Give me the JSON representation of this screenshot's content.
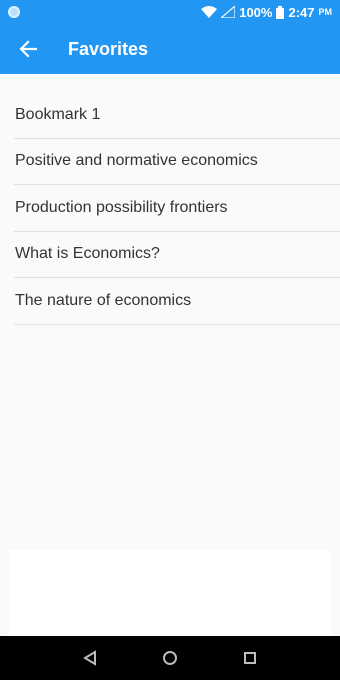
{
  "status_bar": {
    "battery": "100%",
    "time": "2:47",
    "ampm": "PM"
  },
  "app_bar": {
    "title": "Favorites"
  },
  "favorites": [
    "Bookmark 1",
    "Positive and normative economics",
    "Production possibility frontiers",
    "What is Economics?",
    "The nature of economics"
  ],
  "colors": {
    "primary": "#2196f3",
    "background": "#fafafa",
    "nav_bar": "#000000"
  },
  "icons": {
    "back": "arrow-left-icon",
    "nav_back": "triangle-back-icon",
    "nav_home": "circle-home-icon",
    "nav_recent": "square-recent-icon"
  }
}
